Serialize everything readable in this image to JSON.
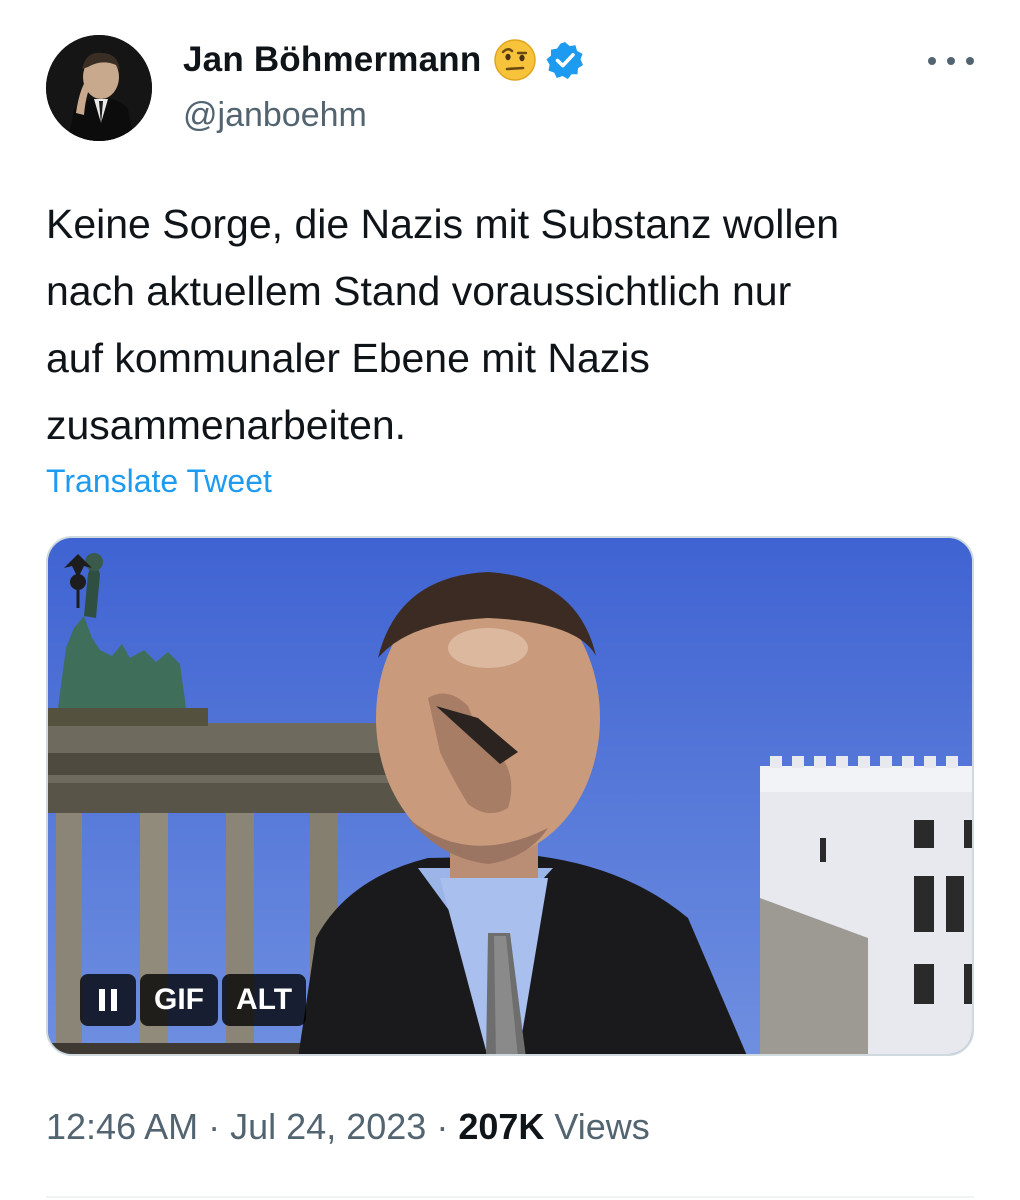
{
  "author": {
    "display_name": "Jan Böhmermann",
    "handle": "@janboehm",
    "emoji_icon": "face-with-raised-eyebrow-icon",
    "verified_icon": "verified-badge-icon",
    "verified_color": "#1d9bf0"
  },
  "more_menu_icon": "more-horizontal-icon",
  "tweet": {
    "text_lines": [
      "Keine Sorge, die Nazis mit Substanz wollen",
      "nach aktuellem Stand voraussichtlich nur",
      "auf kommunaler Ebene mit Nazis",
      "zusammenarbeiten."
    ],
    "translate_label": "Translate Tweet"
  },
  "media": {
    "controls": {
      "pause_icon": "pause-icon",
      "gif_label": "GIF",
      "alt_label": "ALT"
    }
  },
  "meta": {
    "time": "12:46 AM",
    "separator": "·",
    "date": "Jul 24, 2023",
    "views_count": "207K",
    "views_label": "Views"
  },
  "colors": {
    "link": "#1d9bf0",
    "secondary_text": "#536471",
    "primary_text": "#0f1419"
  }
}
